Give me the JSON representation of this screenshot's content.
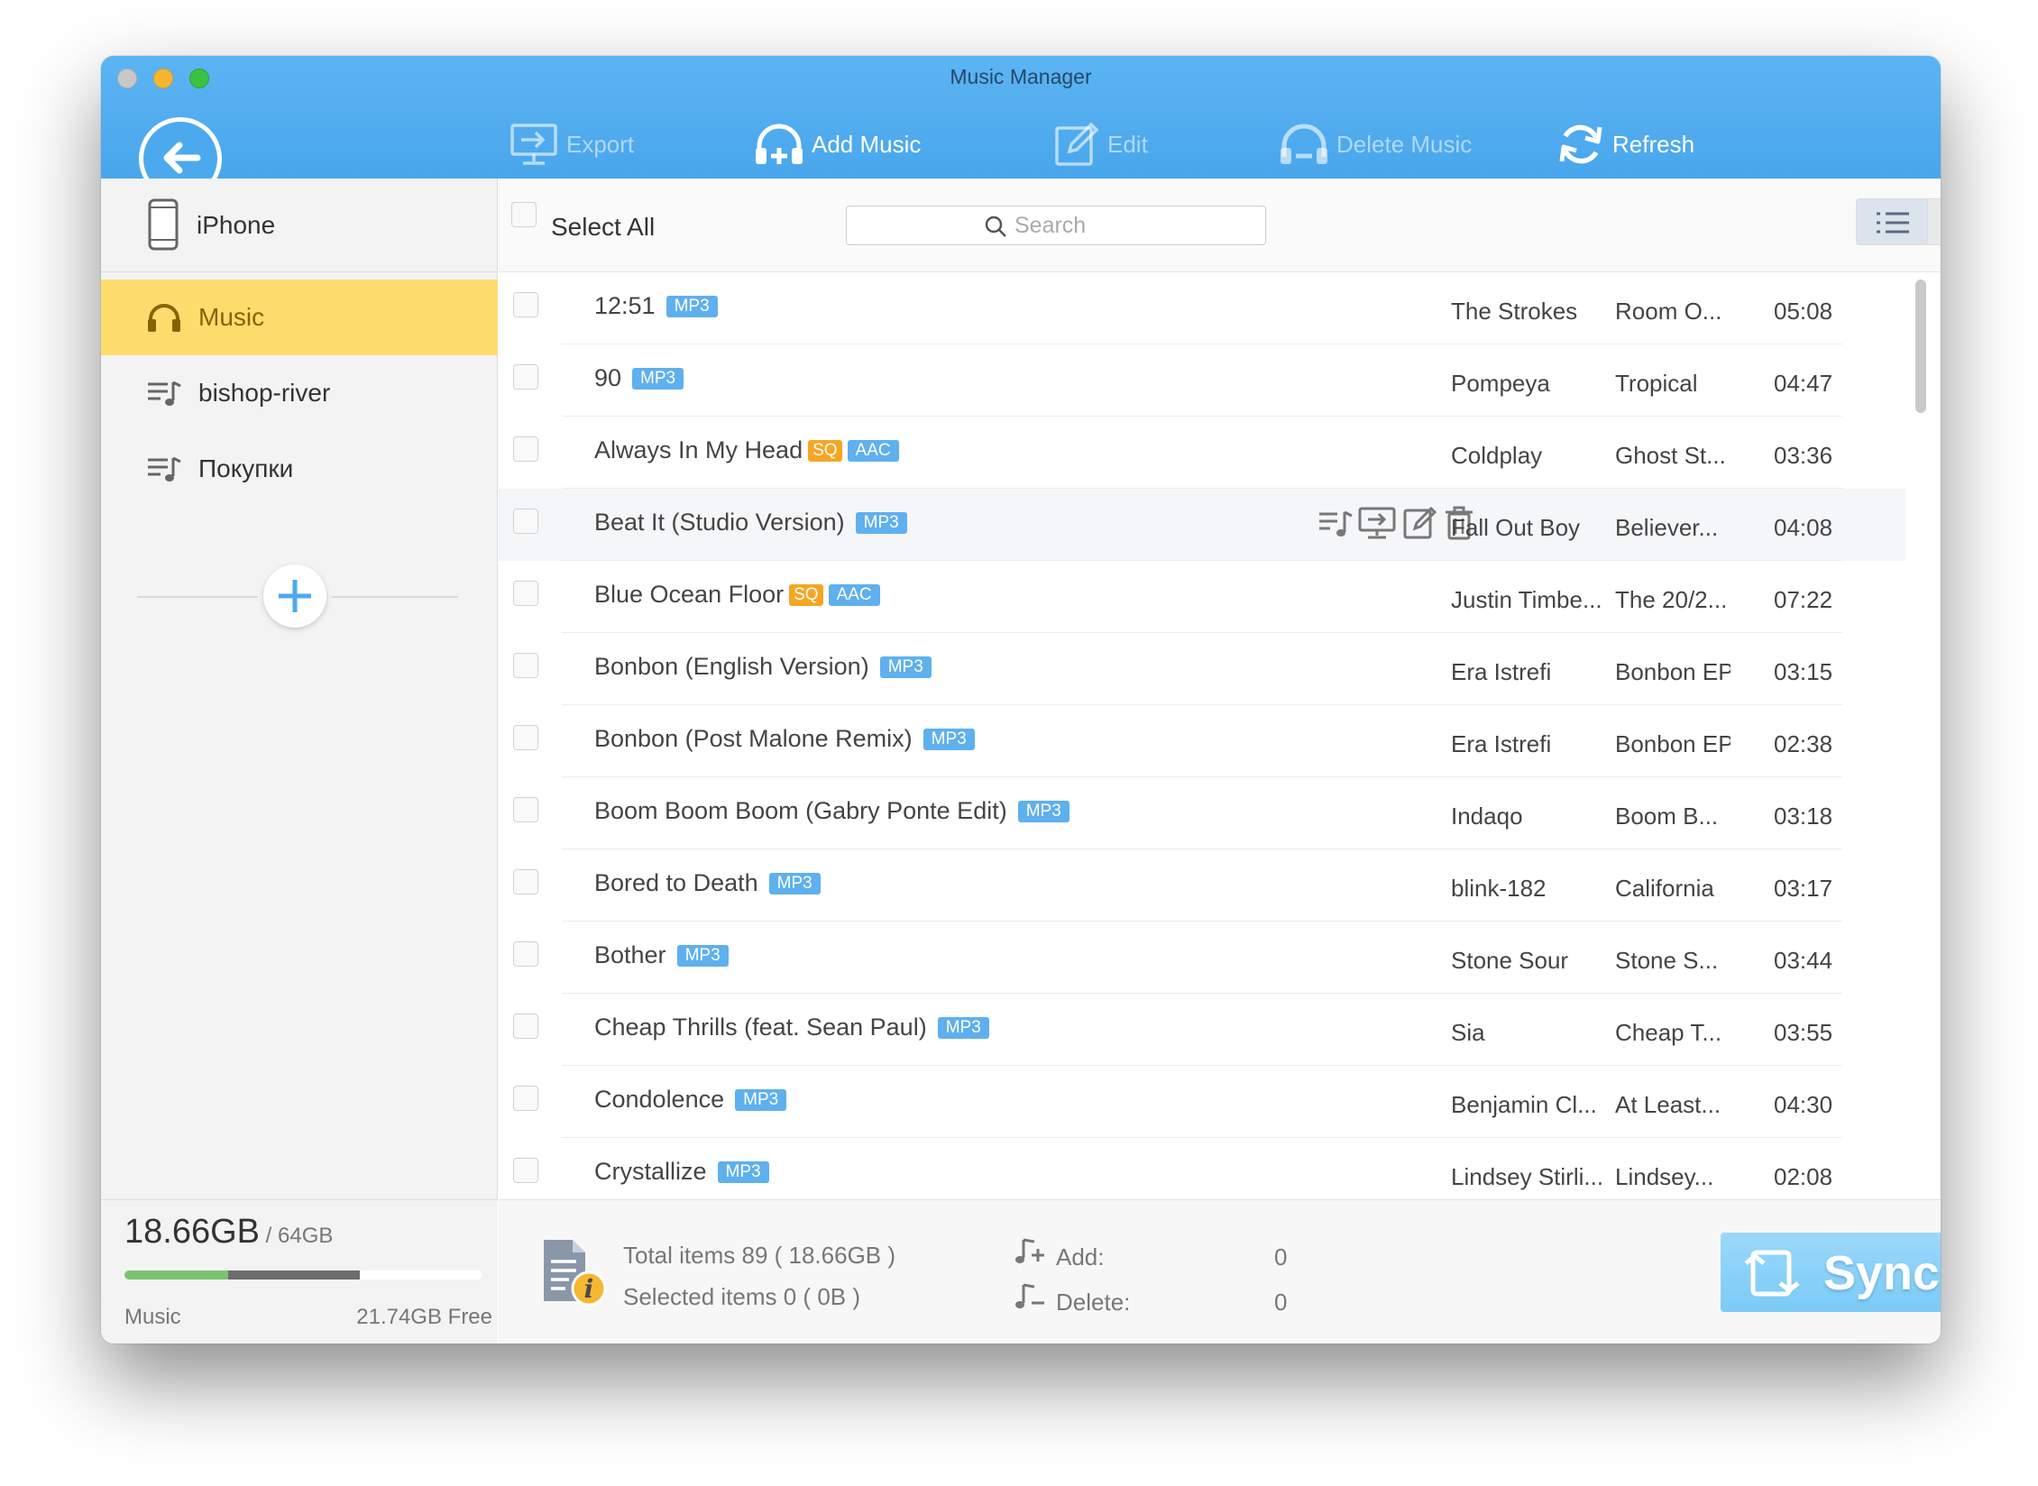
{
  "window": {
    "title": "Music Manager"
  },
  "toolbar": {
    "export_label": "Export",
    "add_music_label": "Add Music",
    "edit_label": "Edit",
    "delete_music_label": "Delete Music",
    "refresh_label": "Refresh"
  },
  "sidebar": {
    "device_name": "iPhone",
    "items": [
      {
        "label": "Music",
        "icon": "headphones-icon",
        "active": true
      },
      {
        "label": "bishop-river",
        "icon": "playlist-icon",
        "active": false
      },
      {
        "label": "Покупки",
        "icon": "playlist-icon",
        "active": false
      }
    ],
    "storage": {
      "used": "18.66GB",
      "total": " / 64GB",
      "category_label": "Music",
      "free": "21.74GB Free",
      "music_fraction": 0.29,
      "other_fraction": 0.37
    }
  },
  "list": {
    "select_all_label": "Select All",
    "search_placeholder": "Search",
    "tracks": [
      {
        "title": "12:51",
        "sq": false,
        "format": "MP3",
        "artist": "The Strokes",
        "album": "Room O...",
        "duration": "05:08"
      },
      {
        "title": "90",
        "sq": false,
        "format": "MP3",
        "artist": "Pompeya",
        "album": "Tropical",
        "duration": "04:47"
      },
      {
        "title": "Always In My Head",
        "sq": true,
        "format": "AAC",
        "artist": "Coldplay",
        "album": "Ghost St...",
        "duration": "03:36"
      },
      {
        "title": "Beat It (Studio Version)",
        "sq": false,
        "format": "MP3",
        "artist": "Fall Out Boy",
        "album": "Believer...",
        "duration": "04:08",
        "hover": true
      },
      {
        "title": "Blue Ocean Floor",
        "sq": true,
        "format": "AAC",
        "artist": "Justin Timbe...",
        "album": "The 20/2...",
        "duration": "07:22"
      },
      {
        "title": "Bonbon (English Version)",
        "sq": false,
        "format": "MP3",
        "artist": "Era Istrefi",
        "album": "Bonbon EP",
        "duration": "03:15"
      },
      {
        "title": "Bonbon (Post Malone Remix)",
        "sq": false,
        "format": "MP3",
        "artist": "Era Istrefi",
        "album": "Bonbon EP",
        "duration": "02:38"
      },
      {
        "title": "Boom Boom Boom (Gabry Ponte Edit)",
        "sq": false,
        "format": "MP3",
        "artist": "Indaqo",
        "album": "Boom B...",
        "duration": "03:18"
      },
      {
        "title": "Bored to Death",
        "sq": false,
        "format": "MP3",
        "artist": "blink-182",
        "album": "California",
        "duration": "03:17"
      },
      {
        "title": "Bother",
        "sq": false,
        "format": "MP3",
        "artist": "Stone Sour",
        "album": "Stone S...",
        "duration": "03:44"
      },
      {
        "title": "Cheap Thrills (feat. Sean Paul)",
        "sq": false,
        "format": "MP3",
        "artist": "Sia",
        "album": "Cheap T...",
        "duration": "03:55"
      },
      {
        "title": "Condolence",
        "sq": false,
        "format": "MP3",
        "artist": "Benjamin Cl...",
        "album": "At Least...",
        "duration": "04:30"
      },
      {
        "title": "Crystallize",
        "sq": false,
        "format": "MP3",
        "artist": "Lindsey Stirli...",
        "album": "Lindsey...",
        "duration": "02:08"
      }
    ],
    "sq_label": "SQ"
  },
  "footer": {
    "total_label": "Total items 89 ( 18.66GB )",
    "selected_label": "Selected items 0 ( 0B )",
    "add_label": "Add:",
    "add_value": "0",
    "delete_label": "Delete:",
    "delete_value": "0",
    "sync_label": "Sync"
  },
  "colors": {
    "accent": "#4ca9ee",
    "active_item": "#fedc6e",
    "format_tag": "#5fb0ee",
    "sq_tag": "#f6a623",
    "storage_music": "#7cc36f"
  }
}
